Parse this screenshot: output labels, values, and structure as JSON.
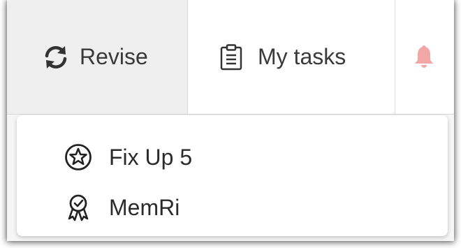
{
  "nav": {
    "revise_label": "Revise",
    "tasks_label": "My tasks",
    "revise_icon": "refresh-icon",
    "tasks_icon": "clipboard-icon",
    "bell_icon": "bell-icon",
    "bell_color": "#f3a6a6"
  },
  "dropdown": {
    "items": [
      {
        "label": "Fix Up 5",
        "icon": "star-badge-icon"
      },
      {
        "label": "MemRi",
        "icon": "award-ribbon-icon"
      }
    ]
  }
}
